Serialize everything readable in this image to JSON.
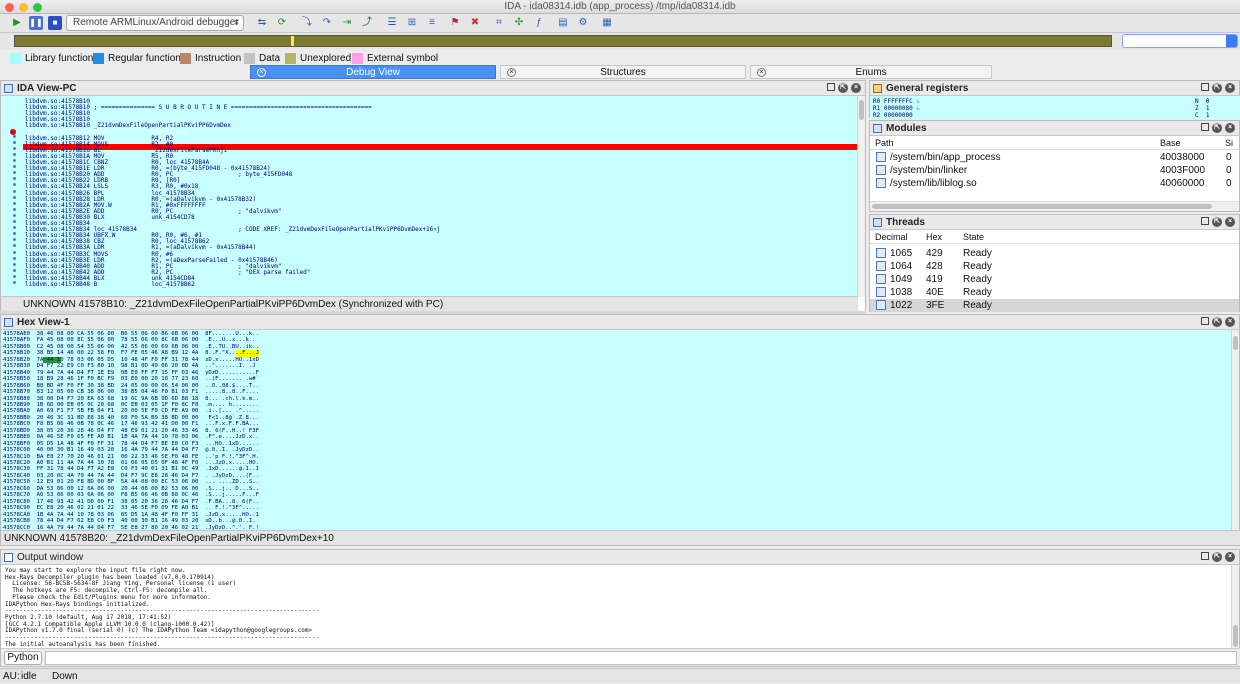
{
  "window": {
    "title": "IDA - ida08314.idb (app_process) /tmp/ida08314.idb"
  },
  "toolbar": {
    "debugger_select": "Remote ARMLinux/Android debugger"
  },
  "legend": [
    {
      "label": "Library function",
      "color": "#a0ffff"
    },
    {
      "label": "Regular function",
      "color": "#1f8fe6"
    },
    {
      "label": "Instruction",
      "color": "#b5876b"
    },
    {
      "label": "Data",
      "color": "#c2c2c2"
    },
    {
      "label": "Unexplored",
      "color": "#b5b565"
    },
    {
      "label": "External symbol",
      "color": "#ff9ee8"
    }
  ],
  "tabs": [
    {
      "label": "Debug View",
      "active": true
    },
    {
      "label": "Structures",
      "active": false
    },
    {
      "label": "Enums",
      "active": false
    }
  ],
  "ida_view": {
    "title": "IDA View-PC",
    "status": "UNKNOWN 41578B10: _Z21dvmDexFileOpenPartialPKviPP6DvmDex (Synchronized with PC)",
    "lines": [
      "libdvm.so:41578B10",
      "libdvm.so:41578B10 ; =============== S U B R O U T I N E =======================================",
      "libdvm.so:41578B10",
      "libdvm.so:41578B10",
      "libdvm.so:41578B10 _Z21dvmDexFileOpenPartialPKviPP6DvmDex",
      "libdvm.so:41578B10 PUSH            {R4-R7,LR}",
      "libdvm.so:41578B12 MOV             R4, R2",
      "libdvm.so:41578B14 MOVS            R2, #0",
      "libdvm.so:41578B16 BL              _Z12dexFileParsePKhji",
      "libdvm.so:41578B1A MOV             R5, R0",
      "libdvm.so:41578B1C CBNZ            R0, loc_41578B4A",
      "libdvm.so:41578B1E LDR             R0, =(byte_415FD048 - 0x41578B24)",
      "libdvm.so:41578B20 ADD             R0, PC                  ; byte_415FD048",
      "libdvm.so:41578B22 LDRB            R0, [R0]",
      "libdvm.so:41578B24 LSLS            R3, R0, #0x18",
      "libdvm.so:41578B26 BPL             loc_41578B34",
      "libdvm.so:41578B28 LDR             R0, =(aDalvikvm - 0x41578B32)",
      "libdvm.so:41578B2A MOV.W           R1, #0xFFFFFFFF",
      "libdvm.so:41578B2E ADD             R0, PC                  ; \"dalvikvm\"",
      "libdvm.so:41578B30 BLX             unk_4154CD78",
      "libdvm.so:41578B34",
      "libdvm.so:41578B34 loc_41578B34                            ; CODE XREF: _Z21dvmDexFileOpenPartialPKviPP6DvmDex+16↑j",
      "libdvm.so:41578B34 UBFX.W          R0, R0, #6, #1",
      "libdvm.so:41578B38 CBZ             R0, loc_41578B62",
      "libdvm.so:41578B3A LDR             R1, =(aDalvikvm - 0x41578B44)",
      "libdvm.so:41578B3C MOVS            R0, #6",
      "libdvm.so:41578B3E LDR             R2, =(aDexParseFailed - 0x41578B46)",
      "libdvm.so:41578B40 ADD             R1, PC                  ; \"dalvikvm\"",
      "libdvm.so:41578B42 ADD             R2, PC                  ; \"DEX parse failed\"",
      "libdvm.so:41578B44 BLX             unk_4154CD84",
      "libdvm.so:41578B48 B               loc_41578B62"
    ]
  },
  "registers": {
    "title": "General registers",
    "values": [
      {
        "name": "R0",
        "value": "FFFFFFFC"
      },
      {
        "name": "R1",
        "value": "00000080"
      },
      {
        "name": "R2",
        "value": "00000000"
      }
    ],
    "flags": [
      {
        "name": "N",
        "value": "0"
      },
      {
        "name": "Z",
        "value": "1"
      },
      {
        "name": "C",
        "value": "1"
      }
    ]
  },
  "modules": {
    "title": "Modules",
    "columns": [
      "Path",
      "Base",
      "Si"
    ],
    "rows": [
      {
        "path": "/system/bin/app_process",
        "base": "40038000",
        "size": "0"
      },
      {
        "path": "/system/bin/linker",
        "base": "4003F000",
        "size": "0"
      },
      {
        "path": "/system/lib/liblog.so",
        "base": "40060000",
        "size": "0"
      }
    ]
  },
  "threads": {
    "title": "Threads",
    "columns": [
      "Decimal",
      "Hex",
      "State"
    ],
    "rows": [
      {
        "dec": "1065",
        "hex": "429",
        "state": "Ready"
      },
      {
        "dec": "1064",
        "hex": "428",
        "state": "Ready"
      },
      {
        "dec": "1049",
        "hex": "419",
        "state": "Ready"
      },
      {
        "dec": "1038",
        "hex": "40E",
        "state": "Ready"
      },
      {
        "dec": "1022",
        "hex": "3FE",
        "state": "Ready"
      }
    ]
  },
  "hex_view": {
    "title": "Hex View-1",
    "status": "UNKNOWN 41578B20: _Z21dvmDexFileOpenPartialPKviPP6DvmDex+10",
    "lines": [
      "41578AE0  38 46 08 00 CA 55 06 00  B6 55 06 00 B6 6B 06 00  8F.......U...k..",
      "41578AF0  FA 45 08 00 8C 55 06 00  78 55 06 00 8C 6B 06 00  .E...U..x...k..",
      "41578B00  C2 45 08 00 54 55 06 00  42 55 06 00 69 6B 06 00  .E..TU..BU..ik..",
      "41578B10  38 B5 14 46 00 22 58 F0  F7 FE 05 46 A8 B9 12 4A  8..F.\"X....F...J",
      "41578B20  7A 44 10 78 03 06 05 D5  10 48 4F F0 FF 31 78 44  zD.x.....HO..1xD",
      "41578B30  D4 F7 22 E9 C0 F3 80 10  98 B1 0D 49 06 20 0D 4A  ..\".......I. .J",
      "41578B40  79 44 7A 44 D4 F7 1E E9  0B E0 FF F7 15 FF 03 46  yDzD...........F",
      "41578B50  18 B9 28 46 1F F0 BC F9  03 E0 00 20 18 77 23 60  ..(F....... .w#`",
      "41578B60  B8 BD 4F F0 FF 30 38 BD  24 05 00 00 06 54 00 00  ..O..08.$....T..",
      "41578B70  83 12 05 00 CB 38 06 00  38 B5 04 46 F0 B1 03 F1  .....8..8..F....",
      "41578B80  38 00 D4 F7 20 EA 63 68  19 6C 9A 6B 9D 6D 88 18  8... .ch.l.k.m..",
      "41578B90  1B 6D 00 EB 05 0C 20 68  0C EB 03 05 1F F0 8C F8  .m.... h........",
      "41578BA0  A0 69 F1 F7 5B FB 04 F1  20 00 5E F0 CD FE A9 00  .i..[... .^.....",
      "41578BB0  20 46 3C 31 BD E8 38 40  60 F0 5A B9 38 BD 00 00   F<1..8@`.Z.8...",
      "41578BC0  F8 B5 06 46 0B 78 0C 46  17 46 93 42 41 D0 00 F1  ...F.x.F.F.BA...",
      "41578BD0  38 05 20 36 28 46 D4 F7  48 E9 01 21 20 46 33 46  8. 6(F..H..! F3F",
      "41578BE0  0A 46 5E F0 65 FE A0 B1  1B 4A 7A 44 10 78 03 06  .F^.e....JzD.x..",
      "41578BF0  05 D5 1A 48 4F F0 FF 31  78 44 D4 F7 BE E8 C0 F3  ...HO..1xD......",
      "41578C00  40 00 30 B1 16 49 03 20  16 4A 79 44 7A 44 D4 F7  @.0..I. .JyDzD..",
      "41578C10  BA E8 27 70 20 46 01 21  00 22 33 46 5E F0 48 FE  ..'p F.!.\"3F^.H.",
      "41578C20  A0 B1 11 4A 7A 44 10 78  01 06 05 D5 0F 48 4F F0  ...JzD.x.....HO.",
      "41578C30  FF 31 78 44 D4 F7 A2 E8  C0 F3 40 01 31 B1 0C 49  .1xD......@.1..I",
      "41578C40  03 20 0C 4A 79 44 7A 44  D4 F7 9C E8 28 46 D4 F7  . .JyDzD....(F..",
      "41578C50  12 E9 01 20 F8 BD 00 BF  5A 44 08 00 EC 53 06 00  ... ....ZD...S..",
      "41578C60  DA 53 06 00 12 6A 06 00  20 44 08 00 B2 53 06 00  .S...j.. D...S..",
      "41578C70  A0 53 06 00 03 6A 06 00  F8 B5 06 46 0B 88 0C 46  .S...j.....F...F",
      "41578C80  17 46 93 42 41 D0 00 F1  38 05 20 36 28 46 D4 F7  .F.BA...8. 6(F..",
      "41578C90  EC E8 20 46 02 21 01 22  33 46 5E F0 09 FE A0 B1  .. F.!.\"3F^.....",
      "41578CA0  1B 4A 7A 44 10 78 03 06  05 D5 1A 48 4F F0 FF 31  .JzD.x.....HO..1",
      "41578CB0  78 44 D4 F7 62 E8 C0 F3  40 00 30 B1 16 49 03 20  xD..b...@.0..I. ",
      "41578CC0  16 4A 79 44 7A 44 D4 F7  5E E8 27 80 20 46 02 21  .JyDzD..^.'. F.!"
    ]
  },
  "output": {
    "title": "Output window",
    "lines": [
      "You may start to explore the input file right now.",
      "Hex-Rays Decompiler plugin has been loaded (v7.0.0.170914)",
      "  License: 56-BC5B-5634-8F Jiang Ying, Personal license (1 user)",
      "  The hotkeys are F5: decompile, Ctrl-F5: decompile all.",
      "  Please check the Edit/Plugins menu for more informaton.",
      "IDAPython Hex-Rays bindings initialized.",
      "---------------------------------------------------------------------------------------",
      "Python 2.7.10 (default, Aug 17 2018, 17:41:52)",
      "[GCC 4.2.1 Compatible Apple LLVM 10.0.0 (clang-1000.0.42)]",
      "IDAPython v1.7.0 final (serial 0) (c) The IDAPython Team <idapython@googlegroups.com>",
      "---------------------------------------------------------------------------------------",
      "The initial autoanalysis has been finished."
    ],
    "python_button": "Python"
  },
  "statusbar": {
    "au_label": "AU:",
    "au_state": "idle",
    "direction": "Down"
  }
}
